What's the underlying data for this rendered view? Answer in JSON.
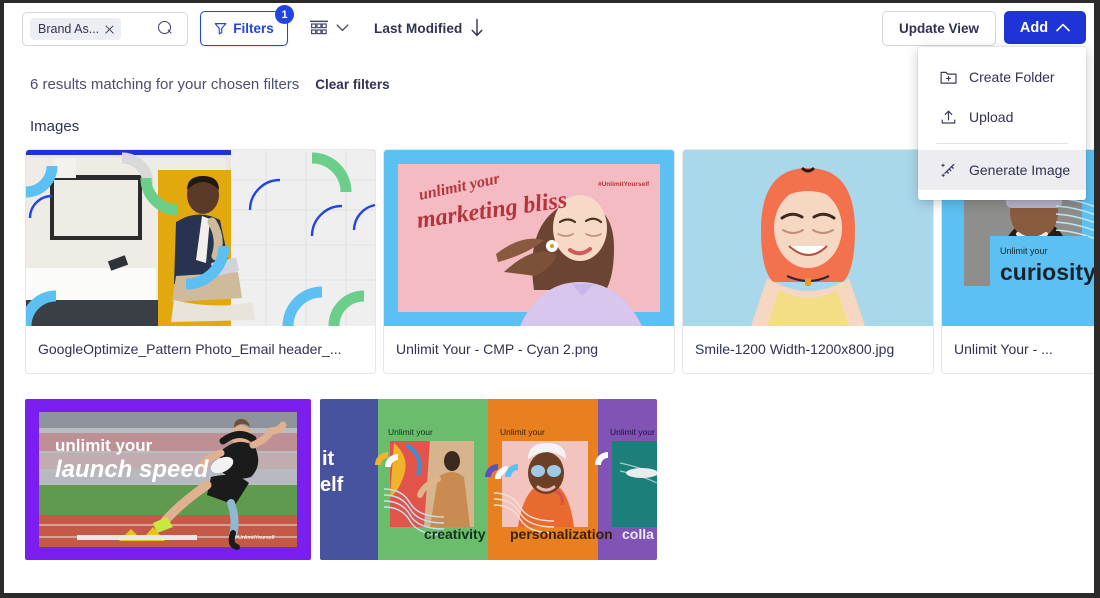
{
  "toolbar": {
    "search_chip": "Brand As...",
    "search_icon": "search-icon",
    "filters_label": "Filters",
    "filters_badge": "1",
    "view_icon": "gallery-view-icon",
    "sort_label": "Last Modified",
    "sort_direction_icon": "arrow-down-icon",
    "update_view_label": "Update View",
    "add_label": "Add",
    "add_caret_icon": "chevron-up-icon"
  },
  "dropdown": {
    "items": [
      {
        "label": "Create Folder",
        "icon": "folder-plus-icon",
        "active": false
      },
      {
        "label": "Upload",
        "icon": "upload-icon",
        "active": false
      },
      {
        "label": "Generate Image",
        "icon": "magic-wand-icon",
        "active": true
      }
    ]
  },
  "results": {
    "summary": "6 results matching for your chosen filters",
    "clear_label": "Clear filters"
  },
  "section": {
    "title": "Images"
  },
  "cards": [
    {
      "caption": "GoogleOptimize_Pattern Photo_Email header_...",
      "art": "office-man-tablet"
    },
    {
      "caption": "Unlimit Your - CMP - Cyan 2.png",
      "art": "marketing-bliss"
    },
    {
      "caption": "Smile-1200 Width-1200x800.jpg",
      "art": "smiling-woman-pink-hair"
    },
    {
      "caption": "Unlimit Your - ...",
      "art": "unlimit-curiosity"
    }
  ],
  "bottom_cards": [
    {
      "art": "launch-speed"
    },
    {
      "art": "unlimit-panels"
    }
  ],
  "art_text": {
    "marketing_line1": "unlimit your",
    "marketing_line2": "marketing bliss",
    "hashtag": "#UnlimitYourself",
    "curiosity_small": "Unlimit your",
    "curiosity_big": "curiosity",
    "launch_line1": "unlimit your",
    "launch_line2": "launch speed",
    "panel_self_1": "it",
    "panel_self_2": "elf",
    "panel_small": "Unlimit your",
    "panel_creativity": "creativity",
    "panel_personalization": "personalization",
    "panel_colla": "colla"
  },
  "colors": {
    "accent": "#1f34d6",
    "filter_blue": "#2244e0",
    "text": "#2f3350",
    "muted": "#4a4f6e",
    "border": "#e4e6ec",
    "cyan": "#62c9f1",
    "pink": "#f4bcc2",
    "purple": "#7b1ff0",
    "green": "#6bbd6e",
    "orange": "#e8801f",
    "indigo": "#47539e",
    "violet": "#8053b4",
    "teal": "#1d7f7a"
  }
}
